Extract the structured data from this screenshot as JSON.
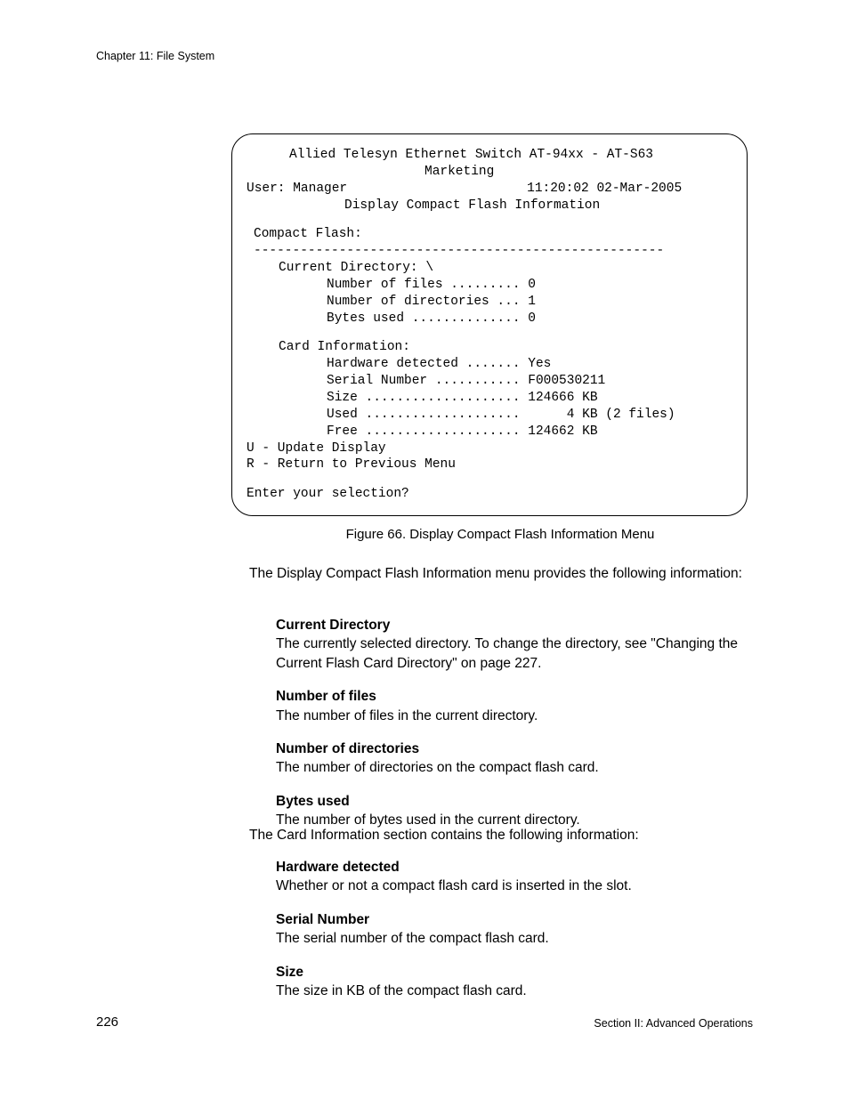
{
  "header": {
    "chapter": "Chapter 11: File System"
  },
  "terminal": {
    "title1": "Allied Telesyn Ethernet Switch AT-94xx - AT-S63",
    "title2": "Marketing",
    "user_label": "User: Manager",
    "timestamp": "11:20:02 02-Mar-2005",
    "screen_title": "Display Compact Flash Information",
    "section_heading": "Compact Flash:",
    "divider": "-----------------------------------------------------",
    "curdir_heading": "Current Directory: \\",
    "curdir_lines": [
      "Number of files ......... 0",
      "Number of directories ... 1",
      "Bytes used .............. 0"
    ],
    "card_heading": "Card Information:",
    "card_lines": [
      "Hardware detected ....... Yes",
      "Serial Number ........... F000530211",
      "Size .................... 124666 KB",
      "Used ....................      4 KB (2 files)",
      "Free .................... 124662 KB"
    ],
    "options": [
      "U - Update Display",
      "R - Return to Previous Menu"
    ],
    "prompt": "Enter your selection?"
  },
  "figure_caption": "Figure 66. Display Compact Flash Information Menu",
  "intro": "The Display Compact Flash Information menu provides the following information:",
  "defs1": [
    {
      "term": "Current Directory",
      "desc": "The currently selected directory. To change the directory, see \"Changing the Current Flash Card Directory\" on page 227."
    },
    {
      "term": "Number of files",
      "desc": "The number of files in the current directory."
    },
    {
      "term": "Number of directories",
      "desc": "The number of directories on the compact flash card."
    },
    {
      "term": "Bytes used",
      "desc": "The number of bytes used in the current directory."
    }
  ],
  "card_intro": "The Card Information section contains the following information:",
  "defs2": [
    {
      "term": "Hardware detected",
      "desc": "Whether or not a compact flash card is inserted in the slot."
    },
    {
      "term": "Serial Number",
      "desc": "The serial number of the compact flash card."
    },
    {
      "term": "Size",
      "desc": "The size in KB of the compact flash card."
    }
  ],
  "footer": {
    "page": "226",
    "section": "Section II: Advanced Operations"
  }
}
